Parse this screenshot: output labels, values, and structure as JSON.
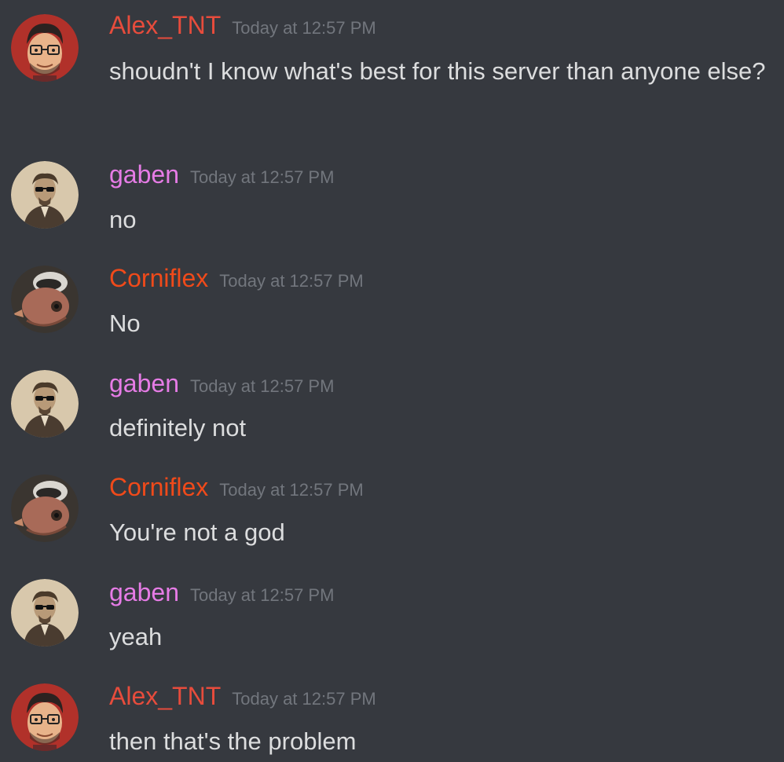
{
  "colors": {
    "background": "#36393f",
    "alex": "#e74c3c",
    "gaben": "#e67ce6",
    "corniflex": "#f04a1a",
    "timestamp": "#72767d",
    "text": "#dcddde"
  },
  "messages": [
    {
      "author": "Alex_TNT",
      "time": "Today at 12:57 PM",
      "text": "shoudn't I know what's best for this server than anyone else?",
      "avatar": "cartoon-glasses-avatar"
    },
    {
      "author": "gaben",
      "time": "Today at 12:57 PM",
      "text": "no",
      "avatar": "sunglasses-portrait-avatar"
    },
    {
      "author": "Corniflex",
      "time": "Today at 12:57 PM",
      "text": "No",
      "avatar": "bird-avatar"
    },
    {
      "author": "gaben",
      "time": "Today at 12:57 PM",
      "text": "definitely not",
      "avatar": "sunglasses-portrait-avatar"
    },
    {
      "author": "Corniflex",
      "time": "Today at 12:57 PM",
      "text": "You're not a god",
      "avatar": "bird-avatar"
    },
    {
      "author": "gaben",
      "time": "Today at 12:57 PM",
      "text": "yeah",
      "avatar": "sunglasses-portrait-avatar"
    },
    {
      "author": "Alex_TNT",
      "time": "Today at 12:57 PM",
      "text": "then that's the problem",
      "avatar": "cartoon-glasses-avatar"
    }
  ]
}
